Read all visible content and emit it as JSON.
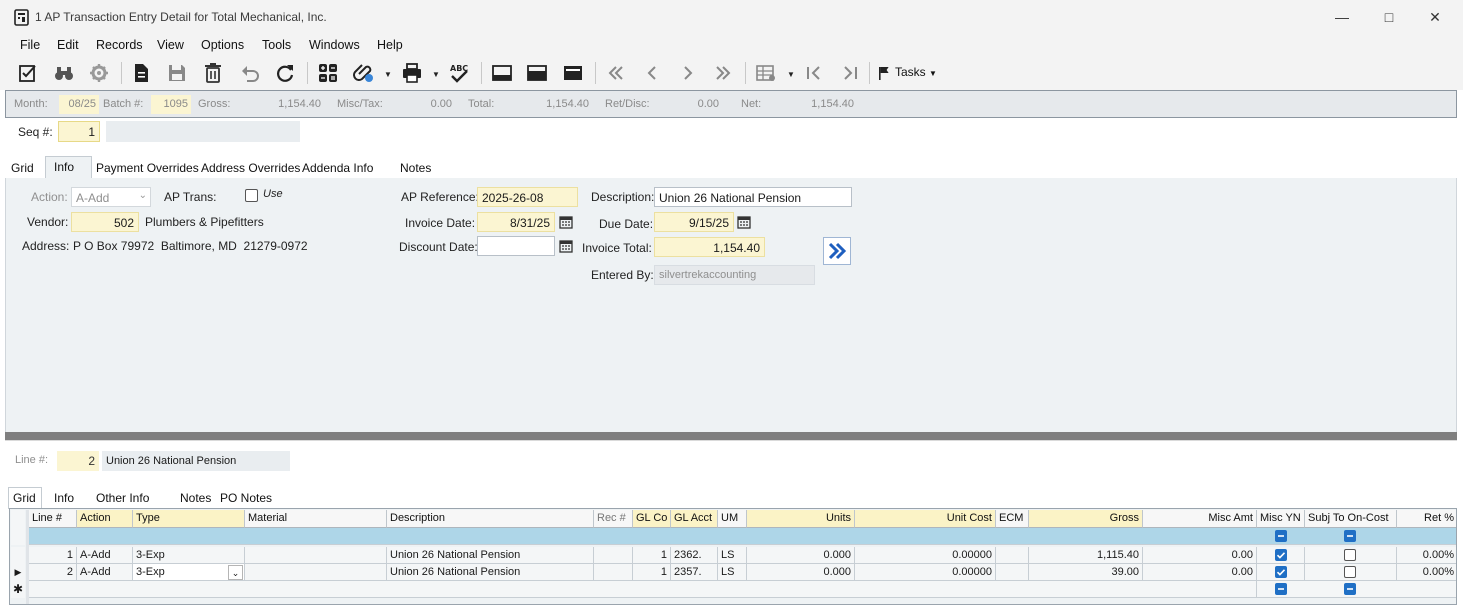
{
  "window": {
    "title": "1 AP Transaction Entry Detail for Total Mechanical, Inc."
  },
  "menu": [
    "File",
    "Edit",
    "Records",
    "View",
    "Options",
    "Tools",
    "Windows",
    "Help"
  ],
  "toolbar": {
    "tasks_label": "Tasks"
  },
  "header": {
    "month_label": "Month:",
    "month_value": "08/25",
    "batch_label": "Batch #:",
    "batch_value": "1095",
    "gross_label": "Gross:",
    "gross_value": "1,154.40",
    "misc_label": "Misc/Tax:",
    "misc_value": "0.00",
    "total_label": "Total:",
    "total_value": "1,154.40",
    "ret_label": "Ret/Disc:",
    "ret_value": "0.00",
    "net_label": "Net:",
    "net_value": "1,154.40"
  },
  "seq": {
    "label": "Seq #:",
    "value": "1"
  },
  "top_tabs": [
    "Grid",
    "Info",
    "Payment Overrides",
    "Address Overrides",
    "Addenda Info",
    "Notes"
  ],
  "info": {
    "action_label": "Action:",
    "action_value": "A-Add",
    "aptrans_label": "AP Trans:",
    "use_label": "Use",
    "vendor_label": "Vendor:",
    "vendor_value": "502",
    "vendor_name": "Plumbers & Pipefitters",
    "address_label": "Address:",
    "address_value": "P O Box 79972  Baltimore, MD  21279-0972",
    "apref_label": "AP Reference:",
    "apref_value": "2025-26-08",
    "invdate_label": "Invoice Date:",
    "invdate_value": "8/31/25",
    "discdate_label": "Discount Date:",
    "discdate_value": "",
    "desc_label": "Description:",
    "desc_value": "Union 26 National Pension",
    "duedate_label": "Due Date:",
    "duedate_value": "9/15/25",
    "invtotal_label": "Invoice Total:",
    "invtotal_value": "1,154.40",
    "enteredby_label": "Entered By:",
    "enteredby_value": "silvertrekaccounting"
  },
  "line": {
    "label": "Line #:",
    "value": "2",
    "desc": "Union 26 National Pension"
  },
  "bottom_tabs": [
    "Grid",
    "Info",
    "Other Info",
    "Notes",
    "PO Notes"
  ],
  "grid": {
    "columns": [
      "Line #",
      "Action",
      "Type",
      "Material",
      "Description",
      "Rec #",
      "GL Co",
      "GL Acct",
      "UM",
      "Units",
      "Unit Cost",
      "ECM",
      "Gross",
      "Misc Amt",
      "Misc YN",
      "Subj To On-Cost",
      "Ret %"
    ],
    "rows": [
      {
        "line": "1",
        "action": "A-Add",
        "type": "3-Exp",
        "material": "",
        "description": "Union 26 National Pension",
        "rec": "",
        "glco": "1",
        "glacct": "2362.",
        "um": "LS",
        "units": "0.000",
        "unitcost": "0.00000",
        "ecm": "",
        "gross": "1,115.40",
        "miscamt": "0.00",
        "miscyn": true,
        "subj": false,
        "ret": "0.00%"
      },
      {
        "line": "2",
        "action": "A-Add",
        "type": "3-Exp",
        "material": "",
        "description": "Union 26 National Pension",
        "rec": "",
        "glco": "1",
        "glacct": "2357.",
        "um": "LS",
        "units": "0.000",
        "unitcost": "0.00000",
        "ecm": "",
        "gross": "39.00",
        "miscamt": "0.00",
        "miscyn": true,
        "subj": false,
        "ret": "0.00%"
      }
    ]
  },
  "colors": {
    "yellow_field": "#fbf5d2",
    "filter_row": "#aed6e8",
    "check_blue": "#1f6fc5"
  }
}
